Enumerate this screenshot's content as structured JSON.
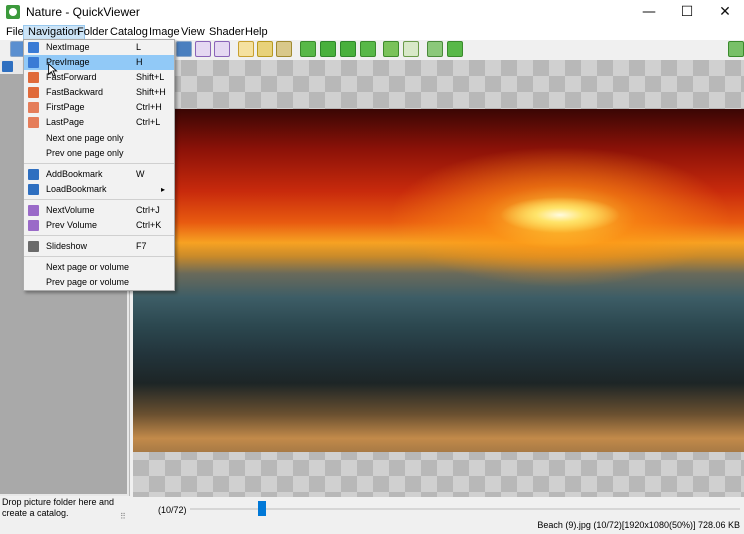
{
  "window": {
    "title": "Nature - QuickViewer",
    "min": "—",
    "max": "☐",
    "close": "✕"
  },
  "menubar": [
    {
      "label": "File"
    },
    {
      "label": "Navigation"
    },
    {
      "label": "Folder"
    },
    {
      "label": "Catalog"
    },
    {
      "label": "Image"
    },
    {
      "label": "View"
    },
    {
      "label": "Shader"
    },
    {
      "label": "Help"
    }
  ],
  "navigation_menu": [
    {
      "label": "NextImage",
      "shortcut": "L",
      "icon": "next-image-icon"
    },
    {
      "label": "PrevImage",
      "shortcut": "H",
      "icon": "prev-image-icon"
    },
    {
      "label": "FastForward",
      "shortcut": "Shift+L",
      "icon": "fast-forward-icon"
    },
    {
      "label": "FastBackward",
      "shortcut": "Shift+H",
      "icon": "fast-backward-icon"
    },
    {
      "label": "FirstPage",
      "shortcut": "Ctrl+H",
      "icon": "first-page-icon"
    },
    {
      "label": "LastPage",
      "shortcut": "Ctrl+L",
      "icon": "last-page-icon"
    },
    {
      "label": "Next one page only",
      "shortcut": ""
    },
    {
      "label": "Prev one page only",
      "shortcut": ""
    },
    {
      "label": "AddBookmark",
      "shortcut": "W",
      "icon": "add-bookmark-icon"
    },
    {
      "label": "LoadBookmark",
      "shortcut": "",
      "submenu": "▸",
      "icon": "load-bookmark-icon"
    },
    {
      "label": "NextVolume",
      "shortcut": "Ctrl+J",
      "icon": "next-volume-icon"
    },
    {
      "label": "Prev Volume",
      "shortcut": "Ctrl+K",
      "icon": "prev-volume-icon"
    },
    {
      "label": "Slideshow",
      "shortcut": "F7",
      "icon": "slideshow-icon"
    },
    {
      "label": "Next page or volume",
      "shortcut": ""
    },
    {
      "label": "Prev page or volume",
      "shortcut": ""
    }
  ],
  "sidebar": {
    "drop_hint": "Drop picture folder here and create a catalog."
  },
  "status": {
    "page_counter": "(10/72)",
    "image_info": "Beach (9).jpg (10/72)[1920x1080(50%)] 728.06 KB",
    "grip": "⠿"
  },
  "slider": {
    "current": 10,
    "total": 72
  },
  "colors": {
    "accent": "#0078d7",
    "menu_highlight": "#91c9f7",
    "menu_open": "#cce4f7"
  }
}
